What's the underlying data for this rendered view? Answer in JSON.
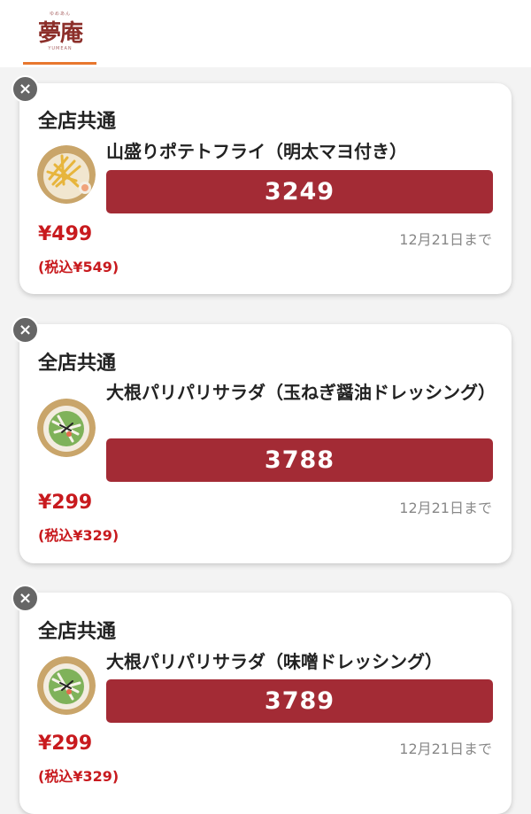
{
  "header": {
    "logo_main": "夢庵",
    "logo_ruby": "ゆめあん",
    "logo_sub": "YUMEAN"
  },
  "coupons": [
    {
      "store": "全店共通",
      "name": "山盛りポテトフライ（明太マヨ付き）",
      "code": "3249",
      "price": "¥499",
      "price_tax": "(税込¥549)",
      "expiry": "12月21日まで",
      "image": "fries-photo"
    },
    {
      "store": "全店共通",
      "name": "大根パリパリサラダ（玉ねぎ醤油ドレッシング）",
      "code": "3788",
      "price": "¥299",
      "price_tax": "(税込¥329)",
      "expiry": "12月21日まで",
      "image": "salad-photo"
    },
    {
      "store": "全店共通",
      "name": "大根パリパリサラダ（味噌ドレッシング）",
      "code": "3789",
      "price": "¥299",
      "price_tax": "(税込¥329)",
      "expiry": "12月21日まで",
      "image": "salad-photo"
    }
  ],
  "colors": {
    "accent": "#e8772e",
    "code_bar": "#a32b35",
    "price": "#c81a1e",
    "logo": "#8c2f2a"
  }
}
